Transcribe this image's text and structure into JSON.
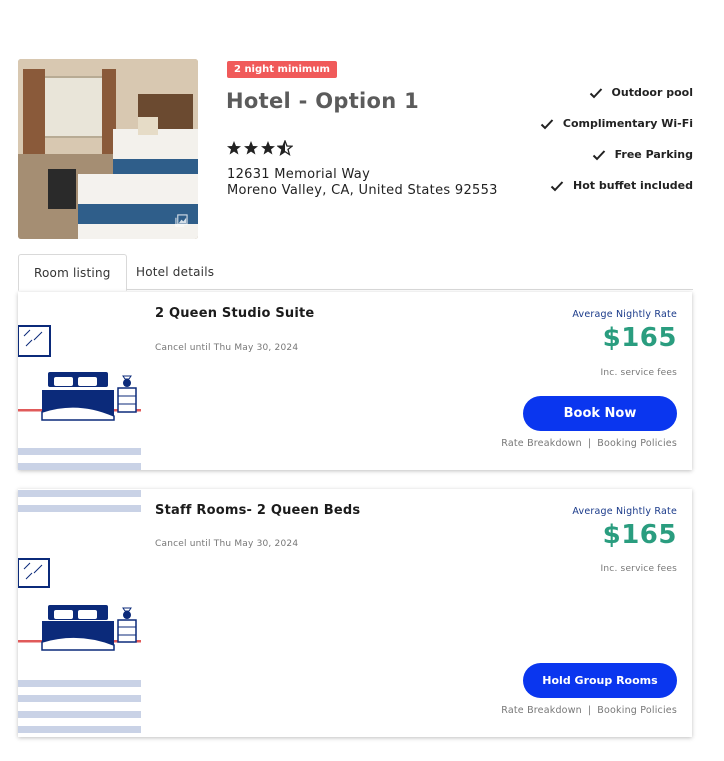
{
  "hotel": {
    "badge": "2 night minimum",
    "name": "Hotel - Option 1",
    "rating": 3.5,
    "address_line1": "12631 Memorial Way",
    "address_line2": "Moreno Valley, CA, United States 92553"
  },
  "amenities": [
    {
      "label": "Outdoor pool",
      "icon": "check-icon"
    },
    {
      "label": "Complimentary Wi-Fi",
      "icon": "check-icon"
    },
    {
      "label": "Free Parking",
      "icon": "check-icon"
    },
    {
      "label": "Hot buffet included",
      "icon": "check-icon"
    }
  ],
  "tabs": [
    {
      "label": "Room listing",
      "active": true
    },
    {
      "label": "Hotel details",
      "active": false
    }
  ],
  "rooms": [
    {
      "name": "2 Queen Studio Suite",
      "cancel": "Cancel until Thu May 30, 2024",
      "rate_label": "Average Nightly Rate",
      "price": "$165",
      "fees": "Inc. service fees",
      "cta": "Book Now",
      "link1": "Rate Breakdown",
      "sep": "|",
      "link2": "Booking Policies"
    },
    {
      "name": "Staff Rooms- 2 Queen Beds",
      "cancel": "Cancel until Thu May 30, 2024",
      "rate_label": "Average Nightly Rate",
      "price": "$165",
      "fees": "Inc. service fees",
      "cta": "Hold Group Rooms",
      "link1": "Rate Breakdown",
      "sep": "|",
      "link2": "Booking Policies"
    }
  ],
  "colors": {
    "badge": "#f05a5a",
    "price": "#2a9d7f",
    "cta": "#0a36ef",
    "rate_label": "#1a3a8a",
    "illustration_navy": "#0b2a7a",
    "illustration_stripe": "#c9d2e6"
  }
}
